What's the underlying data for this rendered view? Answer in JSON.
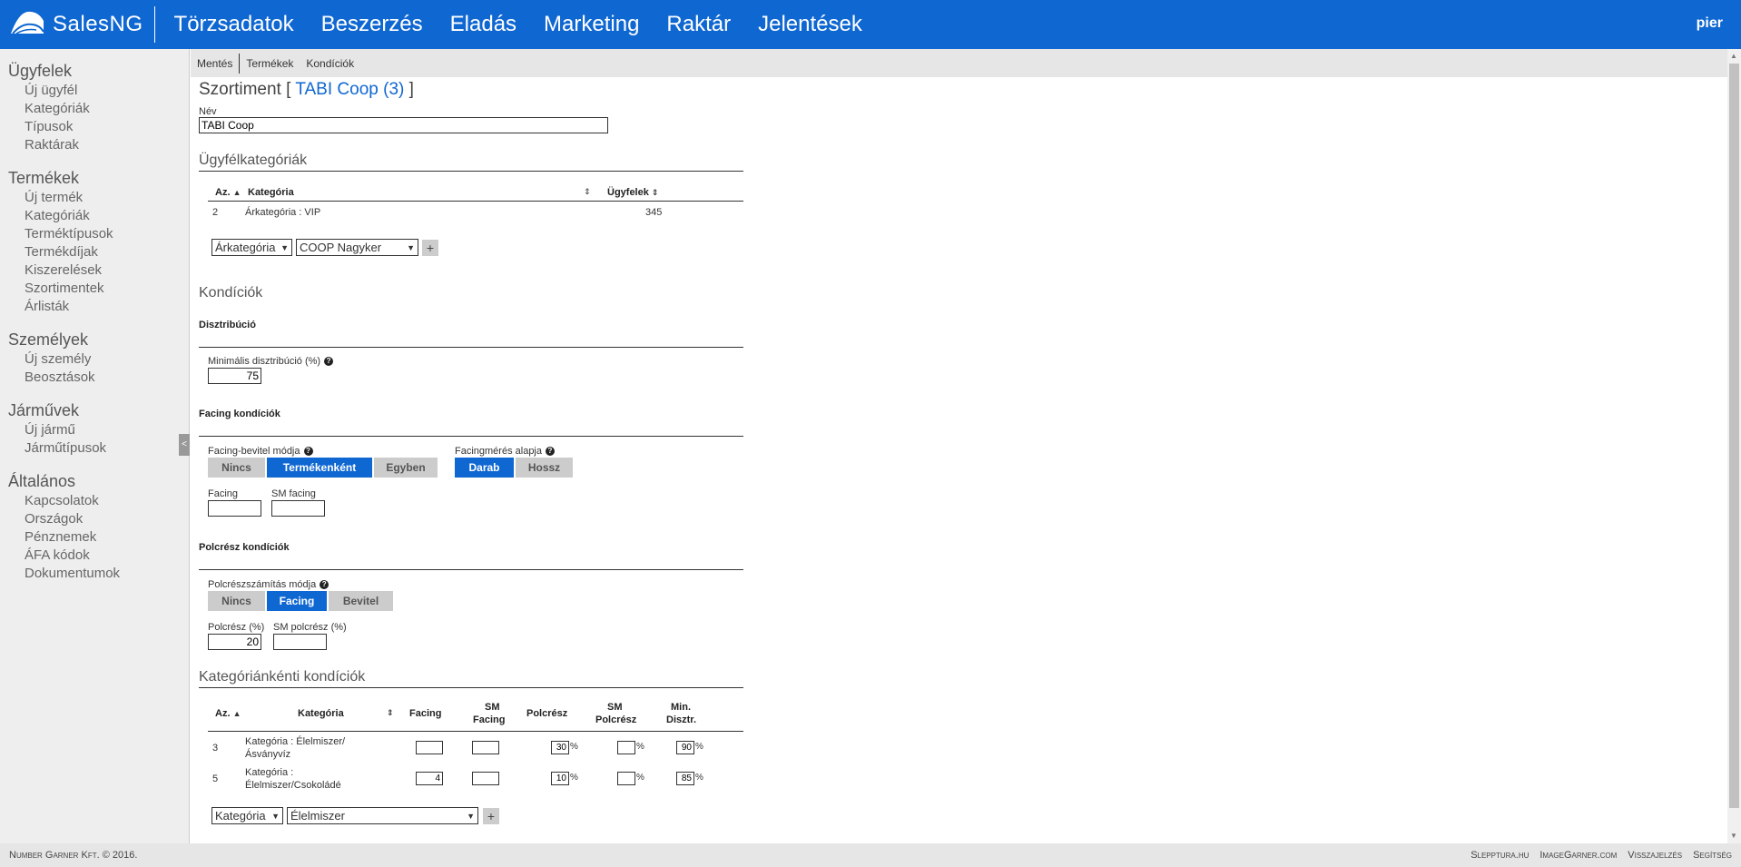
{
  "brand": {
    "name": "SalesNG"
  },
  "nav": [
    "Törzsadatok",
    "Beszerzés",
    "Eladás",
    "Marketing",
    "Raktár",
    "Jelentések"
  ],
  "user": "pier",
  "sidebar": [
    {
      "title": "Ügyfelek",
      "items": [
        "Új ügyfél",
        "Kategóriák",
        "Típusok",
        "Raktárak"
      ]
    },
    {
      "title": "Termékek",
      "items": [
        "Új termék",
        "Kategóriák",
        "Terméktípusok",
        "Termékdíjak",
        "Kiszerelések",
        "Szortimentek",
        "Árlisták"
      ]
    },
    {
      "title": "Személyek",
      "items": [
        "Új személy",
        "Beosztások"
      ]
    },
    {
      "title": "Járművek",
      "items": [
        "Új jármű",
        "Járműtípusok"
      ]
    },
    {
      "title": "Általános",
      "items": [
        "Kapcsolatok",
        "Országok",
        "Pénznemek",
        "ÁFA kódok",
        "Dokumentumok"
      ]
    }
  ],
  "toolbar": [
    "Mentés",
    "Termékek",
    "Kondíciók"
  ],
  "page": {
    "title_prefix": "Szortiment [ ",
    "title_highlight": "TABI Coop (3)",
    "title_suffix": " ]",
    "name_label": "Név",
    "name_value": "TABI Coop"
  },
  "customer_categories": {
    "heading": "Ügyfélkategóriák",
    "col_id": "Az.",
    "col_category": "Kategória",
    "col_customers": "Ügyfelek",
    "rows": [
      {
        "id": "2",
        "category": "Árkategória : VIP",
        "customers": "345"
      }
    ],
    "select1": "Árkategória",
    "select2": "COOP Nagyker",
    "add": "+"
  },
  "conditions": {
    "heading": "Kondíciók",
    "distribution": {
      "heading": "Disztribúció",
      "min_label": "Minimális disztribúció (%)",
      "min_value": "75"
    },
    "facing": {
      "heading": "Facing kondíciók",
      "mode_label": "Facing-bevitel módja",
      "mode_options": [
        "Nincs",
        "Termékenként",
        "Egyben"
      ],
      "mode_selected": "Termékenként",
      "basis_label": "Facingmérés alapja",
      "basis_options": [
        "Darab",
        "Hossz"
      ],
      "basis_selected": "Darab",
      "facing_label": "Facing",
      "facing_value": "",
      "sm_facing_label": "SM facing",
      "sm_facing_value": ""
    },
    "shelf": {
      "heading": "Polcrész kondíciók",
      "mode_label": "Polcrészszámítás módja",
      "mode_options": [
        "Nincs",
        "Facing",
        "Bevitel"
      ],
      "mode_selected": "Facing",
      "share_label": "Polcrész (%)",
      "share_value": "20",
      "sm_share_label": "SM polcrész (%)",
      "sm_share_value": ""
    }
  },
  "category_conditions": {
    "heading": "Kategóriánkénti kondíciók",
    "col_id": "Az.",
    "col_category": "Kategória",
    "col_facing": "Facing",
    "col_sm_facing_1": "SM",
    "col_sm_facing_2": "Facing",
    "col_share": "Polcrész",
    "col_sm_share_1": "SM",
    "col_sm_share_2": "Polcrész",
    "col_min_1": "Min.",
    "col_min_2": "Disztr.",
    "pct": "%",
    "rows": [
      {
        "id": "3",
        "cat1": "Kategória : Élelmiszer/",
        "cat2": "Ásványvíz",
        "facing": "",
        "sm_facing": "",
        "share": "30",
        "sm_share": "",
        "min": "90"
      },
      {
        "id": "5",
        "cat1": "Kategória :",
        "cat2": "Élelmiszer/Csokoládé",
        "facing": "4",
        "sm_facing": "",
        "share": "10",
        "sm_share": "",
        "min": "85"
      }
    ],
    "select1": "Kategória",
    "select2": "Élelmiszer",
    "add": "+"
  },
  "footer": {
    "copyright": "Number Garner Kft. © 2016.",
    "links": [
      "Sleppturа.hu",
      "ImageGarner.com",
      "Visszajelzés",
      "Segítség"
    ]
  }
}
